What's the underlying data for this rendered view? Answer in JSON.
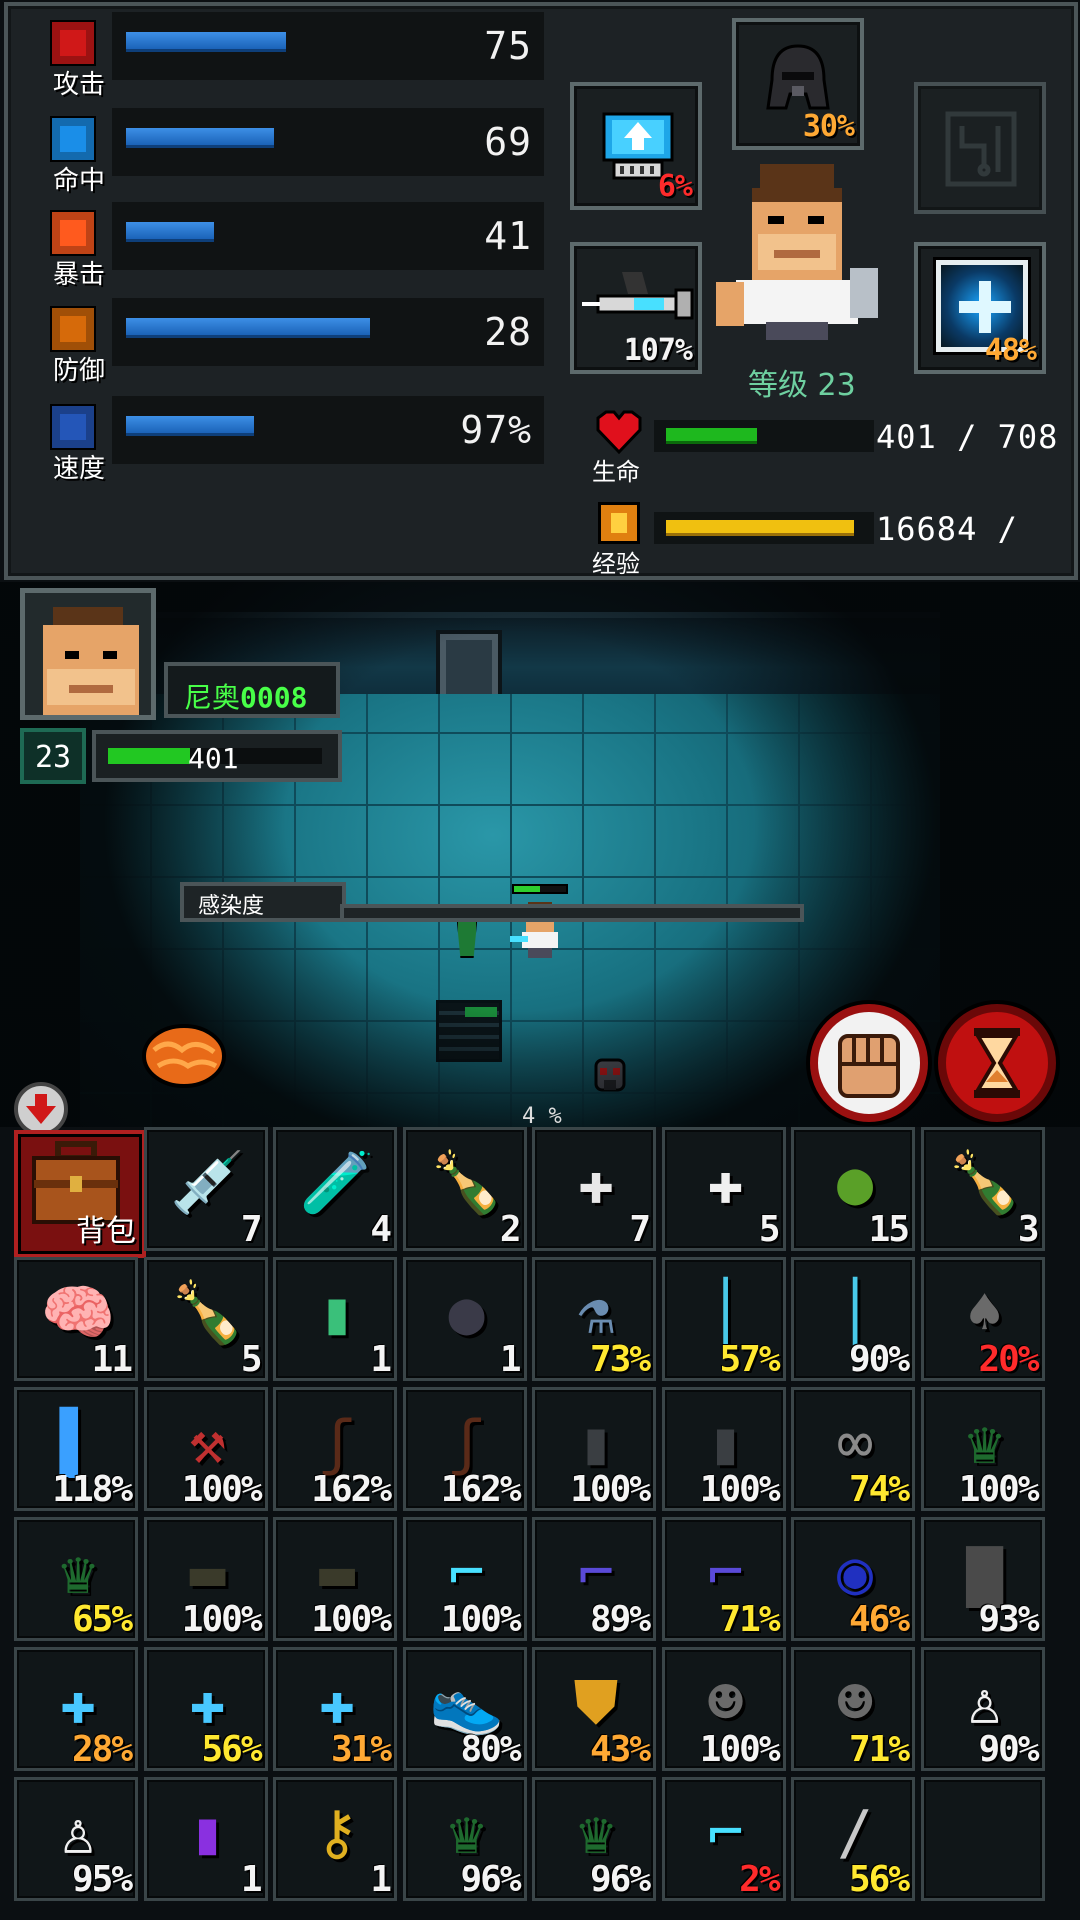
{
  "stats": [
    {
      "label": "攻击",
      "value": "75",
      "fill": 0.4,
      "icon_color": "#d01818"
    },
    {
      "label": "命中",
      "value": "69",
      "fill": 0.37,
      "icon_color": "#1a8ee8"
    },
    {
      "label": "暴击",
      "value": "41",
      "fill": 0.22,
      "icon_color": "#ff5a1e"
    },
    {
      "label": "防御",
      "value": "28",
      "fill": 0.61,
      "icon_color": "#d66a0a"
    },
    {
      "label": "速度",
      "value": "97%",
      "fill": 0.32,
      "icon_color": "#2456b8"
    }
  ],
  "equip": {
    "helmet": {
      "pct": "30%",
      "icon": "helmet-icon"
    },
    "chip": {
      "pct": "6%",
      "icon": "chip-upgrade-icon"
    },
    "empty_slot": {
      "icon": "circuit-slot-icon"
    },
    "weapon": {
      "pct": "107%",
      "icon": "syringe-gun-icon"
    },
    "shield": {
      "pct": "48%",
      "icon": "energy-cross-icon"
    }
  },
  "level_text": "等级 23",
  "hp": {
    "label": "生命",
    "text": "401 / 708",
    "ratio": 0.57
  },
  "exp": {
    "label": "经验",
    "text": "16684 /",
    "ratio": 0.94
  },
  "hud": {
    "name_prefix": "尼奥",
    "name_id": "0008",
    "level": "23",
    "hp": "401"
  },
  "infection": {
    "label": "感染度",
    "value": "4 %"
  },
  "backpack_label": "背包",
  "inventory": [
    {
      "n": "7",
      "icon": "syringe-blue",
      "color": "#5a7de8",
      "glyph": "💉",
      "c": "white"
    },
    {
      "n": "4",
      "icon": "vial-blue",
      "color": "#4a67d8",
      "glyph": "🧪",
      "c": "white"
    },
    {
      "n": "2",
      "icon": "bottle-green",
      "color": "#2b8a3a",
      "glyph": "🍾",
      "c": "white"
    },
    {
      "n": "7",
      "icon": "medkit-small",
      "color": "#e8e8e8",
      "glyph": "✚",
      "c": "white"
    },
    {
      "n": "5",
      "icon": "medkit",
      "color": "#f0f0f0",
      "glyph": "✚",
      "c": "white"
    },
    {
      "n": "15",
      "icon": "green-fruit",
      "color": "#5aa028",
      "glyph": "●",
      "c": "white"
    },
    {
      "n": "3",
      "icon": "bottle-purple",
      "color": "#2f7a3a",
      "glyph": "🍾",
      "c": "white"
    },
    {
      "n": "11",
      "icon": "brain",
      "color": "#e05060",
      "glyph": "🧠",
      "c": "white"
    },
    {
      "n": "5",
      "icon": "bottle-green-2",
      "color": "#2b8a3a",
      "glyph": "🍾",
      "c": "white"
    },
    {
      "n": "1",
      "icon": "canister",
      "color": "#3ac07a",
      "glyph": "▮",
      "c": "white"
    },
    {
      "n": "1",
      "icon": "bomb",
      "color": "#3a3a48",
      "glyph": "●",
      "c": "white"
    },
    {
      "n": "73%",
      "icon": "flask",
      "color": "#6a8cb0",
      "glyph": "⚗",
      "c": "yellow"
    },
    {
      "n": "57%",
      "icon": "tube-cyan",
      "color": "#48c8e8",
      "glyph": "│",
      "c": "yellow"
    },
    {
      "n": "90%",
      "icon": "tube-cyan-2",
      "color": "#48c8e8",
      "glyph": "│",
      "c": "white"
    },
    {
      "n": "20%",
      "icon": "shovel",
      "color": "#6a6a6a",
      "glyph": "♠",
      "c": "red"
    },
    {
      "n": "118%",
      "icon": "energy-blade",
      "color": "#3aa0ff",
      "glyph": "▌",
      "c": "white"
    },
    {
      "n": "100%",
      "icon": "fire-axe",
      "color": "#c03030",
      "glyph": "⚒",
      "c": "white"
    },
    {
      "n": "162%",
      "icon": "cane",
      "color": "#5a2a18",
      "glyph": "ʃ",
      "c": "white"
    },
    {
      "n": "162%",
      "icon": "cane-2",
      "color": "#5a2a18",
      "glyph": "ʃ",
      "c": "white"
    },
    {
      "n": "100%",
      "icon": "plate",
      "color": "#3a3e42",
      "glyph": "▮",
      "c": "white"
    },
    {
      "n": "100%",
      "icon": "plate-2",
      "color": "#3a3e42",
      "glyph": "▮",
      "c": "white"
    },
    {
      "n": "74%",
      "icon": "knuckles",
      "color": "#8a8a8a",
      "glyph": "∞",
      "c": "yellow"
    },
    {
      "n": "100%",
      "icon": "broken-bottle",
      "color": "#1e6a2e",
      "glyph": "♛",
      "c": "white"
    },
    {
      "n": "65%",
      "icon": "broken-bottle-2",
      "color": "#1e6a2e",
      "glyph": "♛",
      "c": "yellow"
    },
    {
      "n": "100%",
      "icon": "rifle",
      "color": "#3a3a2a",
      "glyph": "▬",
      "c": "white"
    },
    {
      "n": "100%",
      "icon": "rifle-2",
      "color": "#3a3a2a",
      "glyph": "▬",
      "c": "white"
    },
    {
      "n": "100%",
      "icon": "laser-gun",
      "color": "#48e0ff",
      "glyph": "⌐",
      "c": "white"
    },
    {
      "n": "89%",
      "icon": "blaster",
      "color": "#5a4ad8",
      "glyph": "⌐",
      "c": "white"
    },
    {
      "n": "71%",
      "icon": "blaster-2",
      "color": "#5a4ad8",
      "glyph": "⌐",
      "c": "yellow"
    },
    {
      "n": "46%",
      "icon": "goggles",
      "color": "#2030c0",
      "glyph": "◉",
      "c": "orange"
    },
    {
      "n": "93%",
      "icon": "armor-vest",
      "color": "#4a4a4a",
      "glyph": "▇",
      "c": "white"
    },
    {
      "n": "28%",
      "icon": "energy-cross",
      "color": "#48c8ff",
      "glyph": "✚",
      "c": "orange"
    },
    {
      "n": "56%",
      "icon": "energy-cross-2",
      "color": "#48c8ff",
      "glyph": "✚",
      "c": "yellow"
    },
    {
      "n": "31%",
      "icon": "energy-cross-3",
      "color": "#48c8ff",
      "glyph": "✚",
      "c": "orange"
    },
    {
      "n": "80%",
      "icon": "sneaker",
      "color": "#e8e8e8",
      "glyph": "👟",
      "c": "white"
    },
    {
      "n": "43%",
      "icon": "gold-shield",
      "color": "#e0a020",
      "glyph": "⛊",
      "c": "orange"
    },
    {
      "n": "100%",
      "icon": "gas-mask",
      "color": "#6a6a6a",
      "glyph": "☻",
      "c": "white"
    },
    {
      "n": "71%",
      "icon": "gas-mask-2",
      "color": "#6a6a6a",
      "glyph": "☻",
      "c": "yellow"
    },
    {
      "n": "90%",
      "icon": "lab-coat",
      "color": "#f0f0f0",
      "glyph": "♙",
      "c": "white"
    },
    {
      "n": "95%",
      "icon": "lab-coat-2",
      "color": "#f0f0f0",
      "glyph": "♙",
      "c": "white"
    },
    {
      "n": "1",
      "icon": "purple-capsule",
      "color": "#8a30e0",
      "glyph": "▮",
      "c": "white"
    },
    {
      "n": "1",
      "icon": "gold-key",
      "color": "#e0b020",
      "glyph": "⚷",
      "c": "white"
    },
    {
      "n": "96%",
      "icon": "broken-bottle-3",
      "color": "#1e6a2e",
      "glyph": "♛",
      "c": "white"
    },
    {
      "n": "96%",
      "icon": "broken-bottle-4",
      "color": "#1e6a2e",
      "glyph": "♛",
      "c": "white"
    },
    {
      "n": "2%",
      "icon": "laser-gun-2",
      "color": "#48e0ff",
      "glyph": "⌐",
      "c": "red"
    },
    {
      "n": "56%",
      "icon": "knife",
      "color": "#c8c8c8",
      "glyph": "∕",
      "c": "yellow"
    }
  ]
}
